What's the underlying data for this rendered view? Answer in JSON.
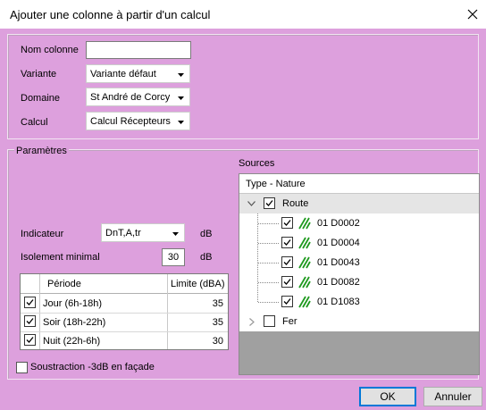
{
  "window": {
    "title": "Ajouter une colonne à partir d'un calcul"
  },
  "form": {
    "nom_colonne_label": "Nom colonne",
    "nom_colonne_value": "",
    "variante_label": "Variante",
    "variante_value": "Variante défaut",
    "domaine_label": "Domaine",
    "domaine_value": "St André de Corcy",
    "calcul_label": "Calcul",
    "calcul_value": "Calcul Récepteurs"
  },
  "params": {
    "legend": "Paramètres",
    "indicateur_label": "Indicateur",
    "indicateur_value": "DnT,A,tr",
    "indicateur_unit": "dB",
    "isolement_label": "Isolement minimal",
    "isolement_value": "30",
    "isolement_unit": "dB",
    "table": {
      "col_periode": "Période",
      "col_limite": "Limite (dBA)",
      "rows": [
        {
          "periode": "Jour (6h-18h)",
          "limite": "35",
          "checked": true
        },
        {
          "periode": "Soir (18h-22h)",
          "limite": "35",
          "checked": true
        },
        {
          "periode": "Nuit (22h-6h)",
          "limite": "30",
          "checked": true
        }
      ]
    },
    "soustraction_label": "Soustraction -3dB en façade",
    "soustraction_checked": false
  },
  "sources": {
    "label": "Sources",
    "header": "Type - Nature",
    "groups": [
      {
        "label": "Route",
        "expanded": true,
        "checked": true,
        "items": [
          "01 D0002",
          "01 D0004",
          "01 D0043",
          "01 D0082",
          "01 D1083"
        ]
      },
      {
        "label": "Fer",
        "expanded": false,
        "checked": false,
        "items": []
      }
    ]
  },
  "buttons": {
    "ok": "OK",
    "annuler": "Annuler"
  },
  "colors": {
    "background": "#dda0dd",
    "selection": "#e5e5e5",
    "road_icon": "#1f9a1f",
    "accent": "#0078d7"
  }
}
